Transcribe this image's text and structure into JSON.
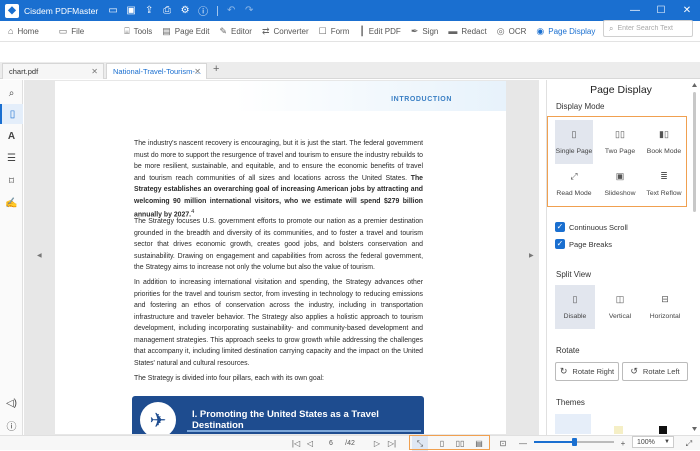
{
  "app": {
    "title": "Cisdem PDFMaster",
    "titlebar_icons": [
      "folder-icon",
      "save-icon",
      "share-icon",
      "print-icon",
      "settings-icon",
      "info-icon",
      "undo-icon",
      "redo-icon"
    ],
    "window": {
      "minimize": "—",
      "maximize": "☐",
      "close": "✕"
    }
  },
  "toolbar": {
    "home": "Home",
    "file": "File",
    "tools": "Tools",
    "page_edit": "Page Edit",
    "editor": "Editor",
    "converter": "Converter",
    "form": "Form",
    "edit_pdf": "Edit PDF",
    "sign": "Sign",
    "redact": "Redact",
    "ocr": "OCR",
    "page_display": "Page Display",
    "search_placeholder": "Enter Search Text"
  },
  "tabs": [
    {
      "label": "chart.pdf",
      "active": false
    },
    {
      "label": "National-Travel-Tourism-...",
      "active": true
    }
  ],
  "document": {
    "header": "INTRODUCTION",
    "paragraphs": [
      "The industry's nascent recovery is encouraging, but it is just the start. The federal government must do more to support the resurgence of travel and tourism to ensure the industry rebuilds to be more resilient, sustainable, and equitable, and to ensure the economic benefits of travel and tourism reach communities of all sizes and locations across the United States.",
      "The Strategy establishes an overarching goal of increasing American jobs by attracting and welcoming 90 million international visitors, who we estimate will spend $279 billion annually by 2027.",
      "The Strategy focuses U.S. government efforts to promote our nation as a premier destination grounded in the breadth and diversity of its communities, and to foster a travel and tourism sector that drives economic growth, creates good jobs, and bolsters conservation and sustainability. Drawing on engagement and capabilities from across the federal government, the Strategy aims to increase not only the volume but also the value of tourism.",
      "In addition to increasing international visitation and spending, the Strategy advances other priorities for the travel and tourism sector, from investing in technology to reducing emissions and fostering an ethos of conservation across the industry, including in transportation infrastructure and traveler behavior. The Strategy also applies a holistic approach to tourism development, including incorporating sustainability- and community-based development and management strategies. This approach seeks to grow growth while addressing the challenges that accompany it, including limited destination carrying capacity and the impact on the United States' natural and cultural resources.",
      "The Strategy is divided into four pillars, each with its own goal:"
    ],
    "footnote_mark": "4",
    "banner": "I. Promoting the United States as a Travel Destination"
  },
  "panel": {
    "title": "Page Display",
    "display_mode_label": "Display Mode",
    "modes": [
      {
        "label": "Single Page",
        "selected": true
      },
      {
        "label": "Two Page",
        "selected": false
      },
      {
        "label": "Book Mode",
        "selected": false
      },
      {
        "label": "Read Mode",
        "selected": false
      },
      {
        "label": "Slideshow",
        "selected": false
      },
      {
        "label": "Text Reflow",
        "selected": false
      }
    ],
    "continuous_scroll": "Continuous Scroll",
    "page_breaks": "Page Breaks",
    "split_view_label": "Split View",
    "split": [
      {
        "label": "Disable",
        "selected": true
      },
      {
        "label": "Vertical",
        "selected": false
      },
      {
        "label": "Horizontal",
        "selected": false
      }
    ],
    "rotate_label": "Rotate",
    "rotate_right": "Rotate Right",
    "rotate_left": "Rotate Left",
    "themes_label": "Themes",
    "theme_colors": [
      "#e6eef9",
      "#ffffff",
      "#f5efc6",
      "#ffffff",
      "#111111"
    ]
  },
  "status": {
    "current_page": "6",
    "total_pages": "/42",
    "zoom": "100%",
    "zoom_fraction": 0.5
  },
  "colors": {
    "brand": "#1a6fd0",
    "highlight": "#f0a050",
    "banner": "#1e4c8f"
  }
}
